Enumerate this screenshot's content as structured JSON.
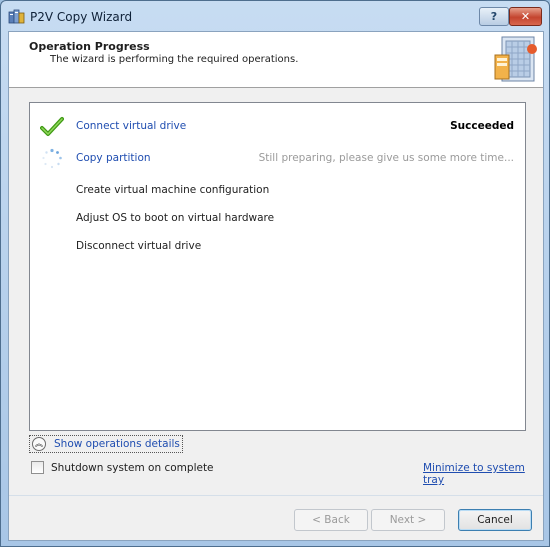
{
  "window": {
    "title": "P2V Copy Wizard",
    "help_label": "?",
    "close_label": "✕"
  },
  "header": {
    "title": "Operation Progress",
    "subtitle": "The wizard is performing the required operations."
  },
  "operations": [
    {
      "label": "Connect virtual drive",
      "status": "Succeeded",
      "state": "done"
    },
    {
      "label": "Copy partition",
      "status": "Still preparing, please give us some more time...",
      "state": "active"
    },
    {
      "label": "Create virtual machine configuration",
      "status": "",
      "state": "pending"
    },
    {
      "label": "Adjust OS to boot on virtual hardware",
      "status": "",
      "state": "pending"
    },
    {
      "label": "Disconnect virtual drive",
      "status": "",
      "state": "pending"
    }
  ],
  "details_toggle": {
    "label": "Show operations details",
    "icon": "chevron-double-up-icon"
  },
  "shutdown_checkbox": {
    "label": "Shutdown system on complete",
    "checked": false
  },
  "minimize_link": "Minimize to system tray",
  "buttons": {
    "back": "< Back",
    "next": "Next >",
    "cancel": "Cancel"
  },
  "colors": {
    "link": "#1f4db0",
    "success_check": "#4caf1f",
    "muted_status": "#9a9a9a"
  }
}
